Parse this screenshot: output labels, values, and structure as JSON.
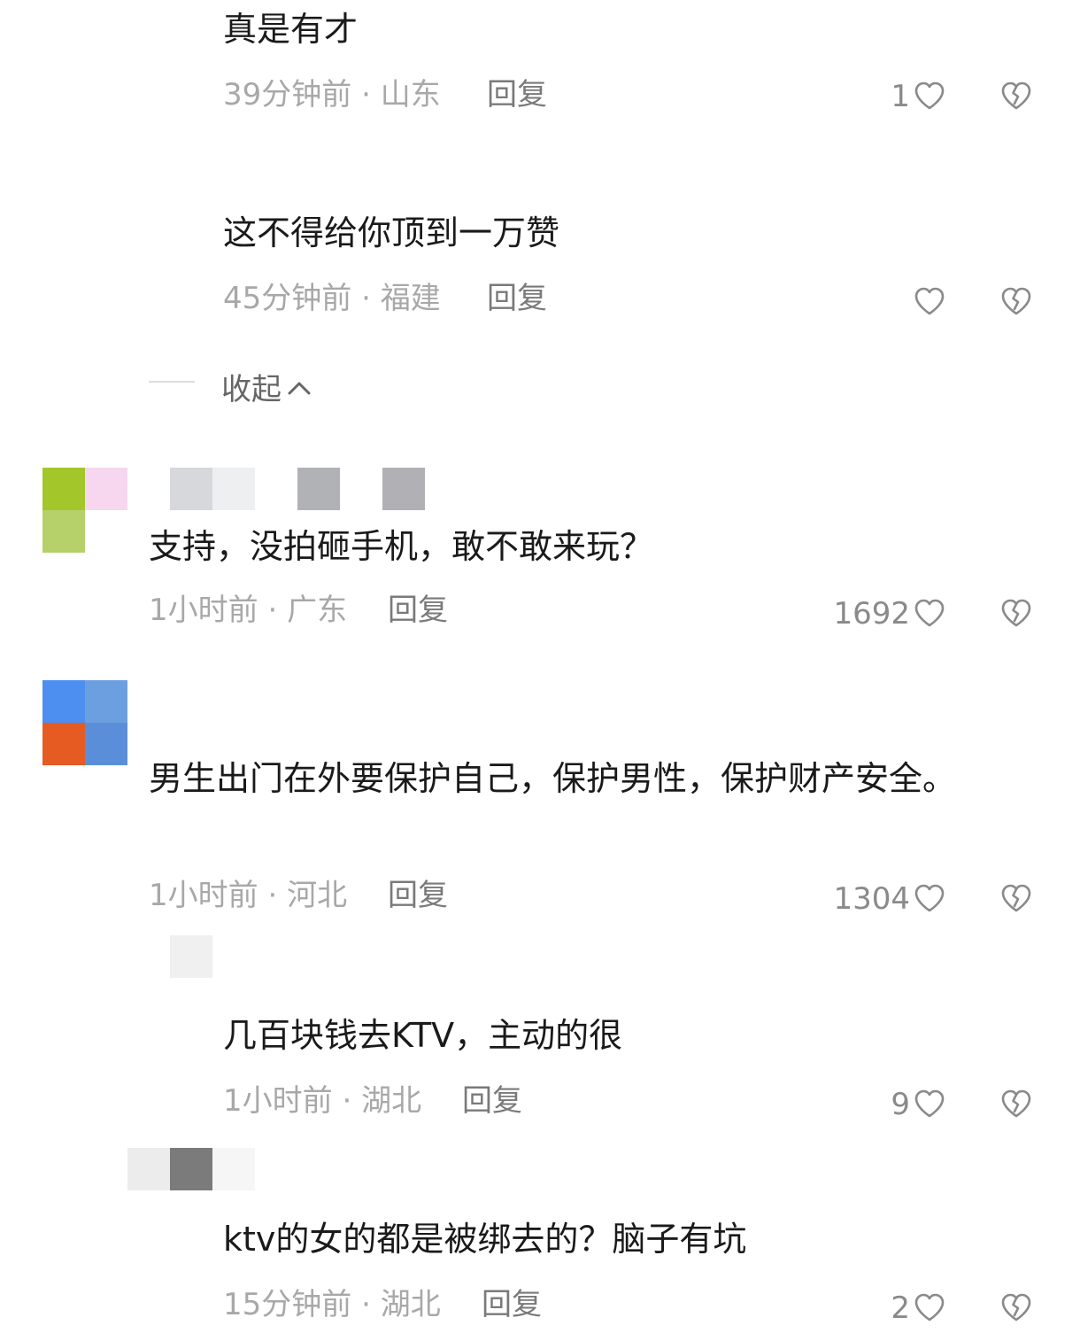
{
  "comments": [
    {
      "text": "真是有才",
      "time": "39分钟前",
      "location": "山东",
      "reply_label": "回复",
      "likes": "1"
    },
    {
      "text": "这不得给你顶到一万赞",
      "time": "45分钟前",
      "location": "福建",
      "reply_label": "回复",
      "likes": ""
    },
    {
      "text": "支持，没拍砸手机，敢不敢来玩？",
      "time": "1小时前",
      "location": "广东",
      "reply_label": "回复",
      "likes": "1692"
    },
    {
      "text": "男生出门在外要保护自己，保护男性，保护财产安全。",
      "time": "1小时前",
      "location": "河北",
      "reply_label": "回复",
      "likes": "1304"
    },
    {
      "text": "几百块钱去KTV，主动的很",
      "time": "1小时前",
      "location": "湖北",
      "reply_label": "回复",
      "likes": "9"
    },
    {
      "text": "ktv的女的都是被绑去的？脑子有坑",
      "time": "15分钟前",
      "location": "湖北",
      "reply_label": "回复",
      "likes": "2"
    }
  ],
  "meta_separator": " · ",
  "collapse_label": "收起",
  "icons": {
    "like": "heart-outline-icon",
    "dislike": "broken-heart-icon",
    "collapse": "chevron-up-icon"
  },
  "colors": {
    "text": "#1a1a1a",
    "meta": "#a8a8a8",
    "reply": "#7a7a7a"
  }
}
